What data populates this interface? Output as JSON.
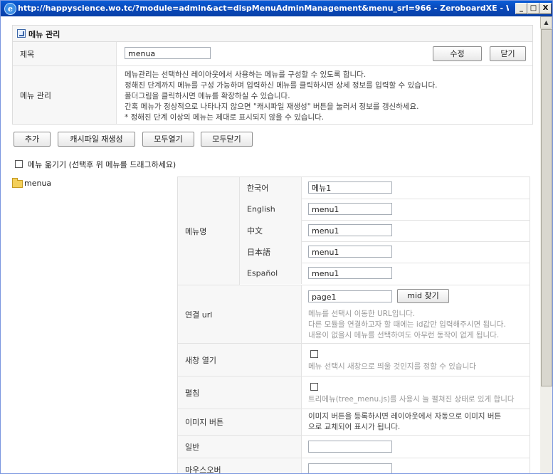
{
  "window": {
    "title": "http://happyscience.wo.tc/?module=admin&act=dispMenuAdminManagement&menu_srl=966 - ZeroboardXE - Windows Internet Explo...",
    "controls": [
      "_",
      "□",
      "X"
    ]
  },
  "panel": {
    "title": "메뉴 관리",
    "name_label": "제목",
    "name_value": "menua",
    "edit_button": "수정",
    "close_button": "닫기",
    "manage_label": "메뉴 관리",
    "description": [
      "메뉴관리는 선택하신 레이아웃에서 사용하는 메뉴를 구성할 수 있도록 합니다.",
      "정해진 단계까지 메뉴를 구성 가능하며 입력하신 메뉴를 클릭하시면 상세 정보를 입력할 수 있습니다.",
      "폴더그림을 클릭하시면 메뉴를 확장하실 수 있습니다.",
      "간혹 메뉴가 정상적으로 나타나지 않으면 \"캐시파일 재생성\" 버튼을 눌러서 정보를 갱신하세요.",
      "* 정해진 단계 이상의 메뉴는 제대로 표시되지 않을 수 있습니다."
    ]
  },
  "toolbar": {
    "add": "추가",
    "regen_cache": "캐시파일 재생성",
    "expand_all": "모두열기",
    "collapse_all": "모두닫기"
  },
  "move_menu_label": "메뉴 옮기기 (선택후 위 메뉴를 드래그하세요)",
  "tree": {
    "root": "menua"
  },
  "form": {
    "menu_name_label": "메뉴명",
    "languages": [
      {
        "lang": "한국어",
        "value": "메뉴1"
      },
      {
        "lang": "English",
        "value": "menu1"
      },
      {
        "lang": "中文",
        "value": "menu1"
      },
      {
        "lang": "日本語",
        "value": "menu1"
      },
      {
        "lang": "Español",
        "value": "menu1"
      }
    ],
    "url_label": "연결 url",
    "url_value": "page1",
    "mid_button": "mid 찾기",
    "url_help": [
      "메뉴를 선택시 이동한 URL입니다.",
      "다른 모듈을 연결하고자 할 때에는 id값만 입력해주시면 됩니다.",
      "내용이 없을시 메뉴를 선택하여도 아무런 동작이 없게 됩니다."
    ],
    "new_window_label": "새창 열기",
    "new_window_help": "메뉴 선택시 새창으로 띄울 것인지를 정할 수 있습니다",
    "expand_label": "펼침",
    "expand_help": "트리메뉴(tree_menu.js)를 사용시 늘 펼쳐진 상태로 있게 합니다",
    "image_button_label": "이미지 버튼",
    "image_button_help": [
      "이미지 버튼을 등록하시면 레이아웃에서 자동으로 이미지 버튼",
      "으로 교체되어 표시가 됩니다."
    ],
    "normal_label": "일반",
    "mouseover_label": "마우스오버"
  }
}
